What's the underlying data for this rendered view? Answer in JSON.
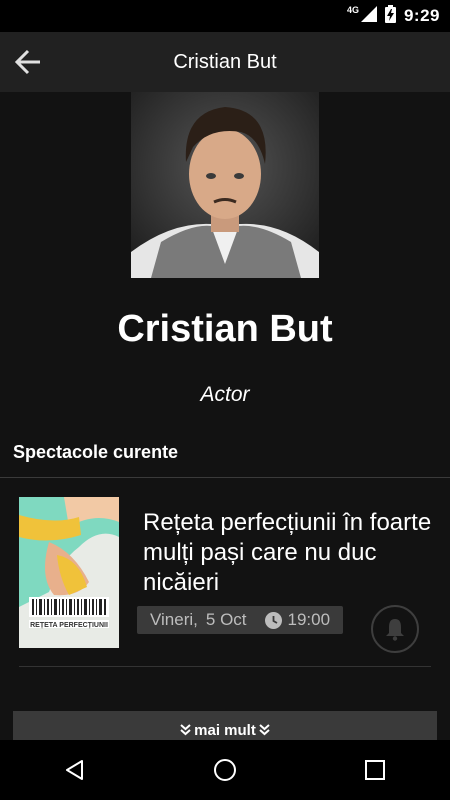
{
  "status_bar": {
    "network": "4G",
    "time": "9:29"
  },
  "app_bar": {
    "title": "Cristian But"
  },
  "profile": {
    "name": "Cristian But",
    "role": "Actor"
  },
  "section": {
    "title": "Spectacole curente"
  },
  "shows": [
    {
      "title": "Rețeta perfecțiunii în foarte mulți pași care nu duc nicăieri",
      "day": "Vineri,",
      "date": "5 Oct",
      "time": "19:00",
      "poster_text": "REȚETA PERFECȚIUNII"
    }
  ],
  "more_button": {
    "label": "mai mult"
  },
  "colors": {
    "background": "#121212",
    "app_bar": "#212121",
    "chip": "#3a3a3a",
    "chip_text": "#bdbdbd"
  }
}
